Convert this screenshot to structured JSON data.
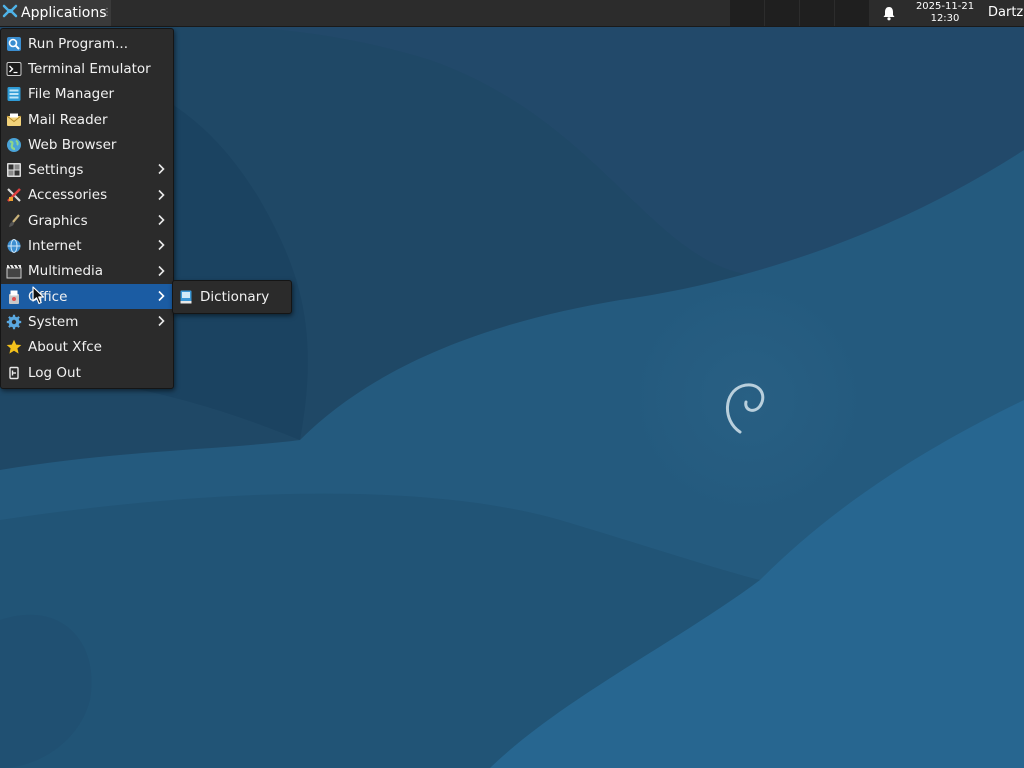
{
  "panel": {
    "apps_label": "Applications",
    "clock_date": "2025-11-21",
    "clock_time": "12:30",
    "user": "Dartz",
    "icons": {
      "apps": "xfce-mouse-icon",
      "notifications": "bell-icon"
    }
  },
  "menu": {
    "items": [
      {
        "label": "Run Program...",
        "icon": "magnifier-icon"
      },
      {
        "label": "Terminal Emulator",
        "icon": "terminal-icon"
      },
      {
        "label": "File Manager",
        "icon": "file-manager-icon"
      },
      {
        "label": "Mail Reader",
        "icon": "mail-icon"
      },
      {
        "label": "Web Browser",
        "icon": "globe-icon"
      },
      {
        "label": "Settings",
        "icon": "settings-icon",
        "submenu": true
      },
      {
        "label": "Accessories",
        "icon": "accessories-icon",
        "submenu": true
      },
      {
        "label": "Graphics",
        "icon": "brush-icon",
        "submenu": true
      },
      {
        "label": "Internet",
        "icon": "internet-icon",
        "submenu": true
      },
      {
        "label": "Multimedia",
        "icon": "clapper-icon",
        "submenu": true
      },
      {
        "label": "Office",
        "icon": "office-icon",
        "submenu": true,
        "highlighted": true
      },
      {
        "label": "System",
        "icon": "gear-icon",
        "submenu": true
      },
      {
        "label": "About Xfce",
        "icon": "star-icon"
      },
      {
        "label": "Log Out",
        "icon": "logout-icon"
      }
    ]
  },
  "submenu": {
    "items": [
      {
        "label": "Dictionary",
        "icon": "dictionary-icon"
      }
    ]
  },
  "colors": {
    "panel_bg": "#2c2c2c",
    "menu_bg": "#2b2b2b",
    "highlight": "#1b5ca3",
    "desktop": "#1d4a6b"
  }
}
